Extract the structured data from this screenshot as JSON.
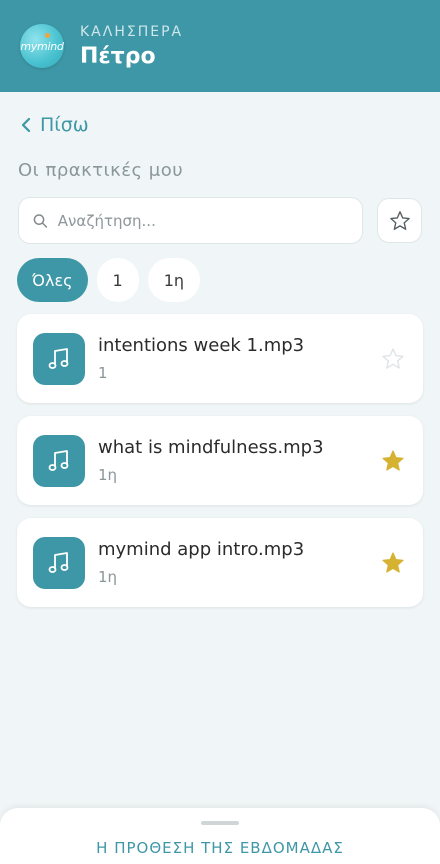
{
  "header": {
    "logo_text": "mymind",
    "greeting": "ΚΑΛΗΣΠΕΡΑ",
    "user_name": "Πέτρο",
    "background_color": "#3e97a6"
  },
  "nav": {
    "back_label": "Πίσω"
  },
  "section": {
    "title": "Οι πρακτικές μου"
  },
  "search": {
    "placeholder": "Αναζήτηση...",
    "value": "",
    "icon": "search-icon"
  },
  "filters": {
    "chips": [
      {
        "label": "Όλες",
        "active": true
      },
      {
        "label": "1",
        "active": false
      },
      {
        "label": "1η",
        "active": false
      }
    ]
  },
  "practices": [
    {
      "title": "intentions week 1.mp3",
      "subtitle": "1",
      "favorite": false,
      "icon": "music-note-icon"
    },
    {
      "title": "what is mindfulness.mp3",
      "subtitle": "1η",
      "favorite": true,
      "icon": "music-note-icon"
    },
    {
      "title": "mymind app intro.mp3",
      "subtitle": "1η",
      "favorite": true,
      "icon": "music-note-icon"
    }
  ],
  "bottom_sheet": {
    "title": "Η ΠΡΟΘΕΣΗ ΤΗΣ ΕΒΔΟΜΑΔΑΣ"
  },
  "colors": {
    "accent": "#3e97a6",
    "star_filled": "#d6b233",
    "star_empty": "#dfe4e6"
  }
}
